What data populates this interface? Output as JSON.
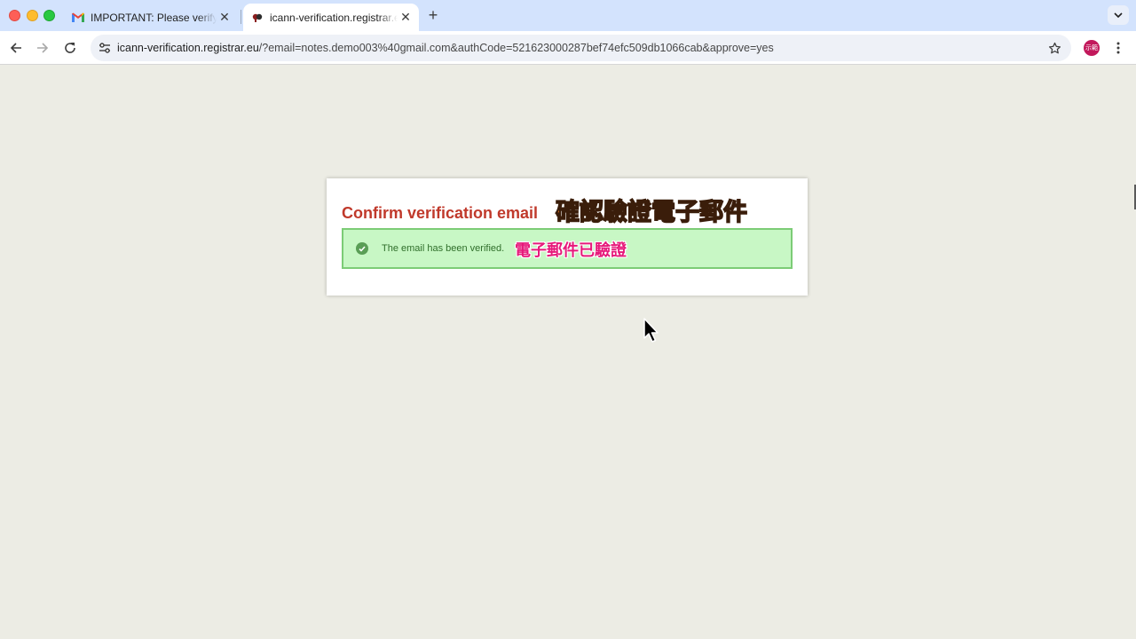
{
  "browser": {
    "tabs": [
      {
        "title": "IMPORTANT: Please verify your",
        "favicon": "gmail-icon",
        "active": false
      },
      {
        "title": "icann-verification.registrar.eu",
        "favicon": "registrar-icon",
        "active": true
      }
    ],
    "address": {
      "domain": "icann-verification.registrar.eu",
      "path": "/?email=notes.demo003%40gmail.com&authCode=521623000287bef74efc509db1066cab&approve=yes"
    },
    "profile_initials": "示範"
  },
  "page": {
    "title": "Confirm verification email",
    "title_annotation": "確認驗證電子郵件",
    "alert_message": "The email has been verified.",
    "alert_annotation": "電子郵件已驗證",
    "colors": {
      "title": "#c0392b",
      "alert_bg": "#c8f7c5",
      "alert_border": "#7ccc76",
      "annotation_orange": "#f47b20",
      "annotation_pink": "#e6197a"
    }
  }
}
